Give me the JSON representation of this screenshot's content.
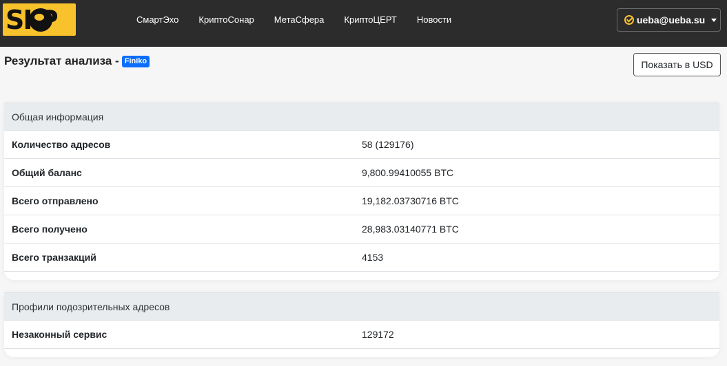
{
  "nav": {
    "logo_text": "SI P",
    "links": [
      "СмартЭхо",
      "КриптоСонар",
      "МетаСфера",
      "КриптоЦЕРТ",
      "Новости"
    ],
    "user": "ueba@ueba.su"
  },
  "header": {
    "title": "Результат анализа -",
    "badge": "Finiko",
    "usd_button": "Показать в USD"
  },
  "general": {
    "title": "Общая информация",
    "rows": [
      {
        "label": "Количество адресов",
        "value": "58 (129176)"
      },
      {
        "label": "Общий баланс",
        "value": "9,800.99410055 BTC"
      },
      {
        "label": "Всего отправлено",
        "value": "19,182.03730716 BTC"
      },
      {
        "label": "Всего получено",
        "value": "28,983.03140771 BTC"
      },
      {
        "label": "Всего транзакций",
        "value": "4153"
      }
    ]
  },
  "suspicious": {
    "title": "Профили подозрительных адресов",
    "rows": [
      {
        "label": "Незаконный сервис",
        "value": "129172"
      }
    ]
  },
  "colors": {
    "navbar": "#2c2c2c",
    "logo": "#f8c22c",
    "badge": "#0d6efd"
  }
}
